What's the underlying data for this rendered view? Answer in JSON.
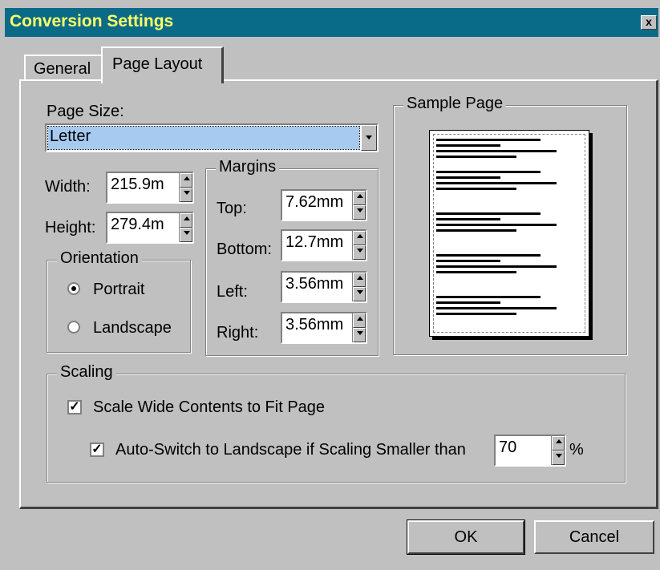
{
  "window": {
    "title": "Conversion Settings",
    "close_label": "x"
  },
  "tabs": [
    {
      "label": "General"
    },
    {
      "label": "Page Layout"
    }
  ],
  "page_size": {
    "label": "Page Size:",
    "value": "Letter"
  },
  "width": {
    "label": "Width:",
    "value": "215.9m"
  },
  "height": {
    "label": "Height:",
    "value": "279.4m"
  },
  "orientation": {
    "legend": "Orientation",
    "portrait": {
      "label": "Portrait",
      "selected": true
    },
    "landscape": {
      "label": "Landscape",
      "selected": false
    }
  },
  "margins": {
    "legend": "Margins",
    "top": {
      "label": "Top:",
      "value": "7.62mm"
    },
    "bottom": {
      "label": "Bottom:",
      "value": "12.7mm"
    },
    "left": {
      "label": "Left:",
      "value": "3.56mm"
    },
    "right": {
      "label": "Right:",
      "value": "3.56mm"
    }
  },
  "sample_page": {
    "legend": "Sample Page"
  },
  "scaling": {
    "legend": "Scaling",
    "scale_wide": {
      "label": "Scale Wide Contents to Fit Page",
      "checked": true
    },
    "auto_switch": {
      "label": "Auto-Switch to Landscape if Scaling Smaller than",
      "checked": true,
      "value": "70",
      "unit": "%"
    }
  },
  "buttons": {
    "ok": "OK",
    "cancel": "Cancel"
  },
  "colors": {
    "titlebar": "#0a6b88",
    "title_text": "#ffff66",
    "selection": "#a6caf0",
    "face": "#c0c0c0"
  }
}
